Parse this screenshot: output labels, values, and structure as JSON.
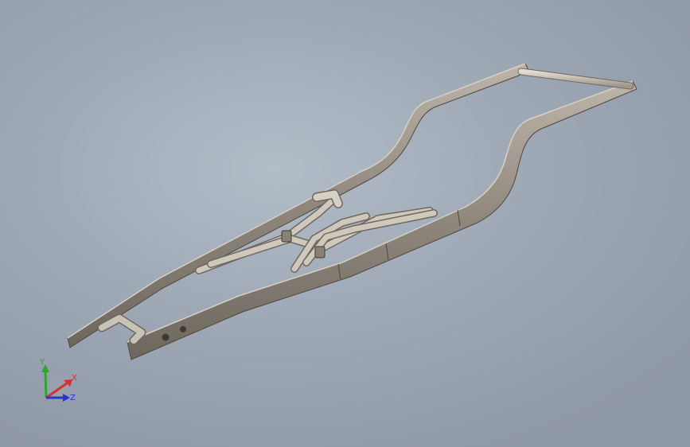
{
  "viewport": {
    "background_top": "#b3bdc8",
    "background_bottom": "#8f98a6"
  },
  "model": {
    "name": "",
    "frame_color": "#8a8176",
    "frame_light": "#b5ada2",
    "tube_color": "#c9c2b6"
  },
  "triad": {
    "x_label": "X",
    "y_label": "Y",
    "z_label": "Z",
    "x_color": "#d9302a",
    "y_color": "#2fa52f",
    "z_color": "#2636c9"
  }
}
